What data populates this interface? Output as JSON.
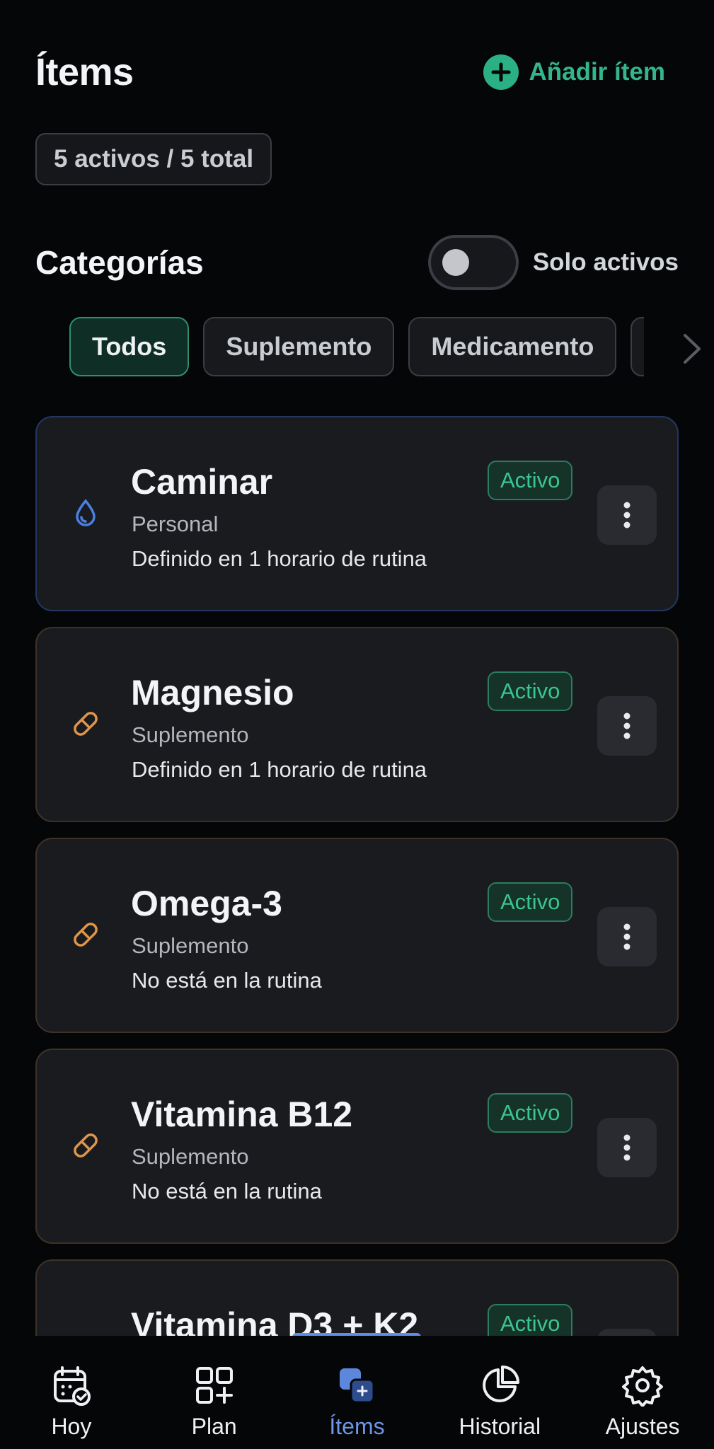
{
  "header": {
    "title": "Ítems",
    "add_label": "Añadir ítem"
  },
  "summary": {
    "count_label": "5 activos / 5 total"
  },
  "categories": {
    "title": "Categorías",
    "only_active_label": "Solo activos",
    "only_active_on": false,
    "filters": [
      "Todos",
      "Suplemento",
      "Medicamento"
    ],
    "selected": "Todos"
  },
  "items": [
    {
      "name": "Caminar",
      "category": "Personal",
      "routine": "Definido en 1 horario de rutina",
      "status": "Activo",
      "icon": "drop-icon"
    },
    {
      "name": "Magnesio",
      "category": "Suplemento",
      "routine": "Definido en 1 horario de rutina",
      "status": "Activo",
      "icon": "pill-icon"
    },
    {
      "name": "Omega-3",
      "category": "Suplemento",
      "routine": "No está en la rutina",
      "status": "Activo",
      "icon": "pill-icon"
    },
    {
      "name": "Vitamina B12",
      "category": "Suplemento",
      "routine": "No está en la rutina",
      "status": "Activo",
      "icon": "pill-icon"
    },
    {
      "name": "Vitamina D3 + K2",
      "status": "Activo",
      "icon": "pill-icon"
    }
  ],
  "nav": [
    {
      "label": "Hoy",
      "icon": "calendar-check-icon"
    },
    {
      "label": "Plan",
      "icon": "grid-plus-icon"
    },
    {
      "label": "Ítems",
      "icon": "items-icon",
      "active": true
    },
    {
      "label": "Historial",
      "icon": "pie-chart-icon"
    },
    {
      "label": "Ajustes",
      "icon": "gear-icon"
    }
  ],
  "colors": {
    "accent_green": "#34b58a",
    "accent_blue": "#6f96e6",
    "pill_orange": "#e0954a",
    "drop_blue": "#4a80e0"
  }
}
